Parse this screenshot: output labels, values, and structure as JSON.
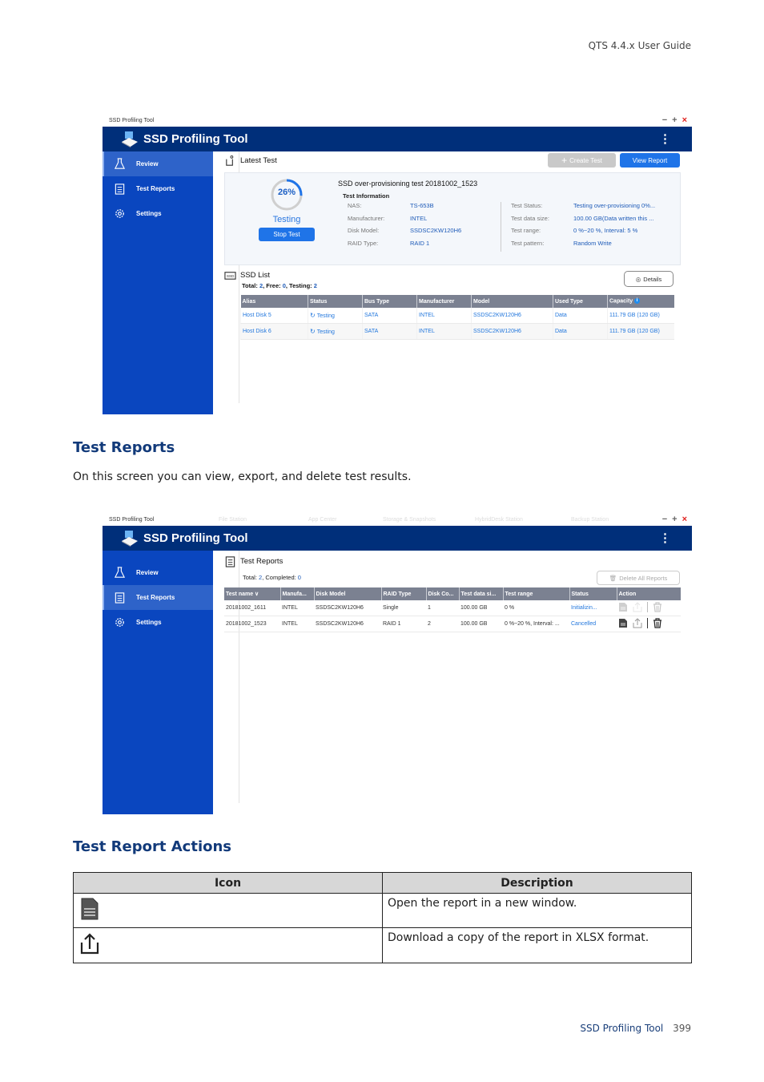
{
  "page": {
    "header": "QTS 4.4.x User Guide",
    "footer_section": "SSD Profiling Tool",
    "page_number": "399"
  },
  "shot1": {
    "window_title": "SSD Profiling Tool",
    "app_title": "SSD Profiling Tool",
    "sidebar": [
      {
        "label": "Review",
        "icon": "flask-icon",
        "active": true
      },
      {
        "label": "Test Reports",
        "icon": "clipboard-icon",
        "active": false
      },
      {
        "label": "Settings",
        "icon": "gear-icon",
        "active": false
      }
    ],
    "latest_test": {
      "heading": "Latest Test",
      "create_test_label": "Create Test",
      "view_report_label": "View Report",
      "progress_percent": 26,
      "progress_label": "26%",
      "state": "Testing",
      "stop_test_label": "Stop Test",
      "test_title": "SSD over-provisioning test 20181002_1523",
      "info_heading": "Test Information",
      "left_info": [
        {
          "key": "NAS:",
          "value": "TS-653B"
        },
        {
          "key": "Manufacturer:",
          "value": "INTEL"
        },
        {
          "key": "Disk Model:",
          "value": "SSDSC2KW120H6"
        },
        {
          "key": "RAID Type:",
          "value": "RAID 1"
        }
      ],
      "right_info": [
        {
          "key": "Test Status:",
          "value": "Testing over-provisioning 0%..."
        },
        {
          "key": "Test data size:",
          "value": "100.00 GB(Data written this ..."
        },
        {
          "key": "Test range:",
          "value": "0 %~20 %, Interval: 5 %"
        },
        {
          "key": "Test pattern:",
          "value": "Random Write"
        }
      ]
    },
    "ssd_list": {
      "heading": "SSD List",
      "total_label": "Total: ",
      "total": "2",
      "free_label": ", Free: ",
      "free": "0",
      "testing_label": ", Testing: ",
      "testing": "2",
      "details_label": "Details",
      "columns": [
        "Alias",
        "Status",
        "Bus Type",
        "Manufacturer",
        "Model",
        "Used Type",
        "Capacity"
      ],
      "rows": [
        [
          "Host Disk 5",
          "Testing",
          "SATA",
          "INTEL",
          "SSDSC2KW120H6",
          "Data",
          "111.79 GB (120 GB)"
        ],
        [
          "Host Disk 6",
          "Testing",
          "SATA",
          "INTEL",
          "SSDSC2KW120H6",
          "Data",
          "111.79 GB (120 GB)"
        ]
      ]
    }
  },
  "section1": {
    "heading": "Test Reports",
    "body": "On this screen you can view, export, and delete test results."
  },
  "shot2": {
    "window_title": "SSD Profiling Tool",
    "background_tabs": [
      "File Station",
      "App Center",
      "Storage & Snapshots",
      "HybridDesk Station",
      "Backup Station"
    ],
    "app_title": "SSD Profiling Tool",
    "sidebar": [
      {
        "label": "Review",
        "icon": "flask-icon",
        "active": false
      },
      {
        "label": "Test Reports",
        "icon": "clipboard-icon",
        "active": true
      },
      {
        "label": "Settings",
        "icon": "gear-icon",
        "active": false
      }
    ],
    "reports": {
      "heading": "Test Reports",
      "total_label": "Total: ",
      "total": "2",
      "completed_label": ", Completed: ",
      "completed": "0",
      "delete_all_label": "Delete All Reports",
      "columns": [
        "Test name ∨",
        "Manufa...",
        "Disk Model",
        "RAID Type",
        "Disk Co...",
        "Test data si...",
        "Test range",
        "Status",
        "Action"
      ],
      "rows": [
        {
          "cells": [
            "20181002_1611",
            "INTEL",
            "SSDSC2KW120H6",
            "Single",
            "1",
            "100.00 GB",
            "0 %"
          ],
          "status": "Initializin...",
          "actions_enabled": false
        },
        {
          "cells": [
            "20181002_1523",
            "INTEL",
            "SSDSC2KW120H6",
            "RAID 1",
            "2",
            "100.00 GB",
            "0 %~20 %, Interval: ..."
          ],
          "status": "Cancelled",
          "actions_enabled": true
        }
      ]
    }
  },
  "section2": {
    "heading": "Test Report Actions",
    "table": {
      "headers": [
        "Icon",
        "Description"
      ],
      "rows": [
        {
          "icon": "document-icon",
          "description": "Open the report in a new window."
        },
        {
          "icon": "export-icon",
          "description": "Download a copy of the report in XLSX format."
        }
      ]
    }
  }
}
